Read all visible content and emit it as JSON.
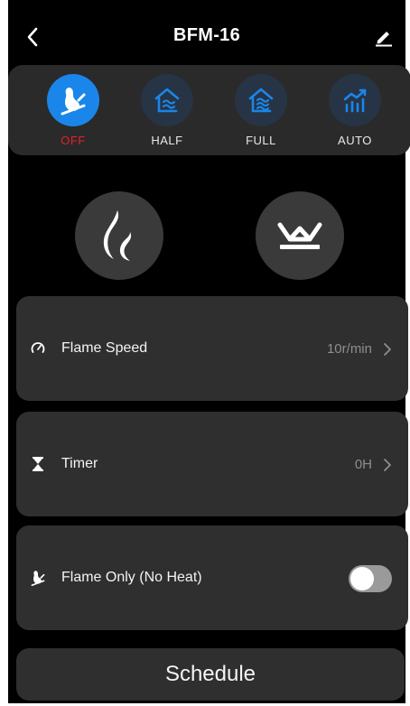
{
  "header": {
    "title": "BFM-16"
  },
  "modes": [
    {
      "label": "OFF",
      "icon": "flame-off-icon",
      "active": true
    },
    {
      "label": "HALF",
      "icon": "house-half-heat-icon",
      "active": false
    },
    {
      "label": "FULL",
      "icon": "house-full-heat-icon",
      "active": false
    },
    {
      "label": "AUTO",
      "icon": "auto-chart-icon",
      "active": false
    }
  ],
  "controls": {
    "flame_button_icon": "flame-icon",
    "crown_button_icon": "crown-lamp-icon"
  },
  "settings": {
    "flame_speed": {
      "label": "Flame Speed",
      "value": "10r/min",
      "icon": "speedometer-icon"
    },
    "timer": {
      "label": "Timer",
      "value": "0H",
      "icon": "hourglass-icon"
    },
    "flame_only": {
      "label": "Flame Only (No Heat)",
      "icon": "flame-off-icon",
      "enabled": false
    }
  },
  "schedule": {
    "label": "Schedule"
  },
  "colors": {
    "active_mode": "#1a86ea",
    "inactive_mode": "#263445",
    "off_label": "#e0222a",
    "card": "#2f2f2f"
  }
}
